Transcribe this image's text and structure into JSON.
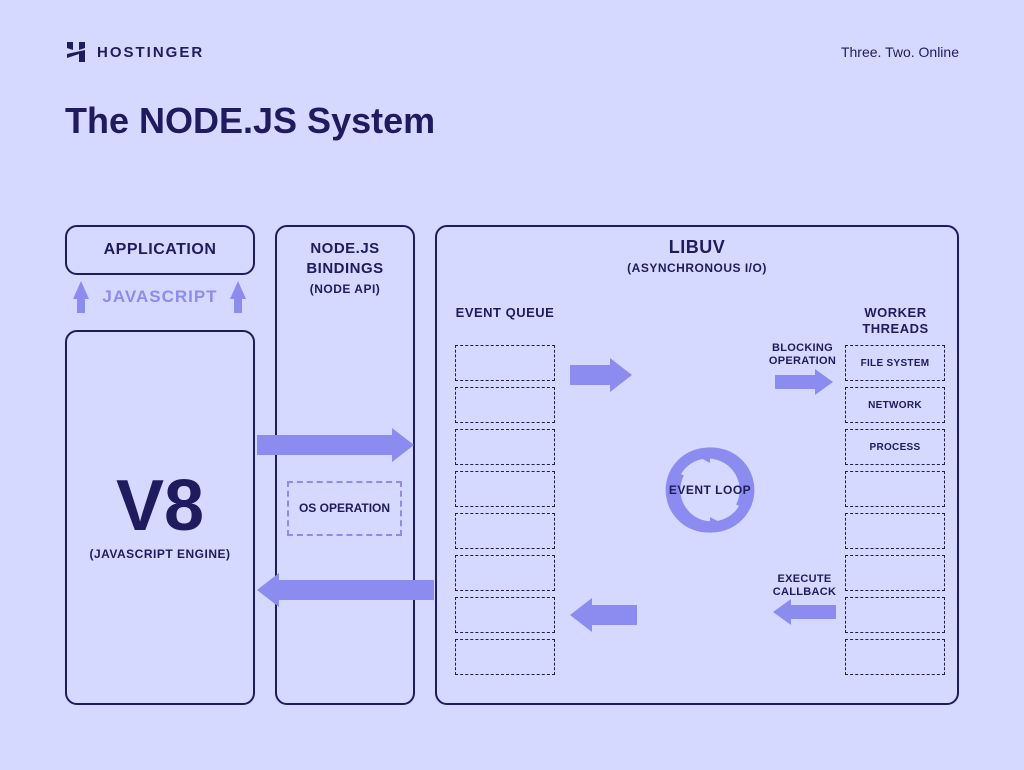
{
  "header": {
    "brand": "HOSTINGER",
    "tagline": "Three. Two. Online"
  },
  "title": "The NODE.JS System",
  "application": {
    "label": "APPLICATION"
  },
  "javascript": {
    "label": "JAVASCRIPT"
  },
  "v8": {
    "label": "V8",
    "sub": "(JAVASCRIPT ENGINE)"
  },
  "bindings": {
    "title": "NODE.JS BINDINGS",
    "sub": "(NODE API)"
  },
  "os_operation": {
    "label": "OS OPERATION"
  },
  "libuv": {
    "title": "LIBUV",
    "sub": "(ASYNCHRONOUS I/O)",
    "event_queue_label": "EVENT QUEUE",
    "worker_threads_label": "WORKER THREADS",
    "event_loop_label": "EVENT LOOP",
    "blocking_label": "BLOCKING OPERATION",
    "callback_label": "EXECUTE CALLBACK",
    "workers": [
      "FILE SYSTEM",
      "NETWORK",
      "PROCESS",
      "",
      "",
      "",
      "",
      ""
    ]
  }
}
